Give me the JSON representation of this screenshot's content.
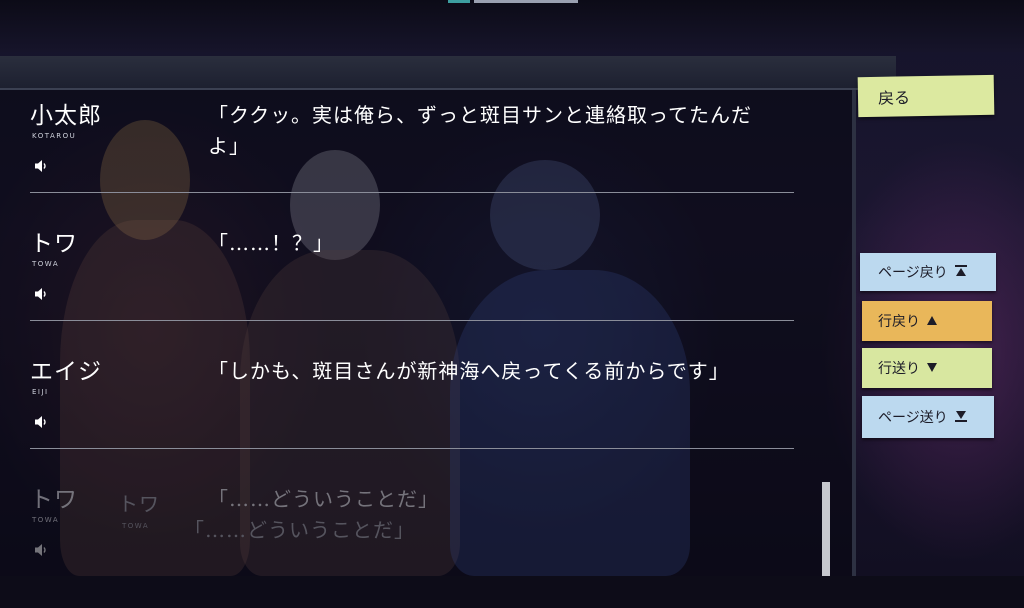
{
  "log": {
    "entries": [
      {
        "name": "小太郎",
        "romaji": "KOTAROU",
        "text": "「ククッ。実は俺ら、ずっと斑目サンと連絡取ってたんだよ」"
      },
      {
        "name": "トワ",
        "romaji": "TOWA",
        "text": "「……！？」"
      },
      {
        "name": "エイジ",
        "romaji": "EIJI",
        "text": "「しかも、斑目さんが新神海へ戻ってくる前からです」"
      },
      {
        "name": "トワ",
        "romaji": "TOWA",
        "text": "「……どういうことだ」"
      }
    ],
    "ghost": {
      "name": "トワ",
      "romaji": "TOWA",
      "text": "「……どういうことだ」"
    }
  },
  "controls": {
    "back": "戻る",
    "page_up": "ページ戻り",
    "line_up": "行戻り",
    "line_down": "行送り",
    "page_down": "ページ送り"
  },
  "icons": {
    "voice": "speaker-icon",
    "page_up": "double-up-icon",
    "line_up": "triangle-up-icon",
    "line_down": "triangle-down-icon",
    "page_down": "double-down-icon"
  },
  "colors": {
    "back_button": "#dce9a0",
    "page_button": "#bcd9ef",
    "line_up_button": "#e9b75a",
    "line_down_button": "#d8e7a0"
  }
}
